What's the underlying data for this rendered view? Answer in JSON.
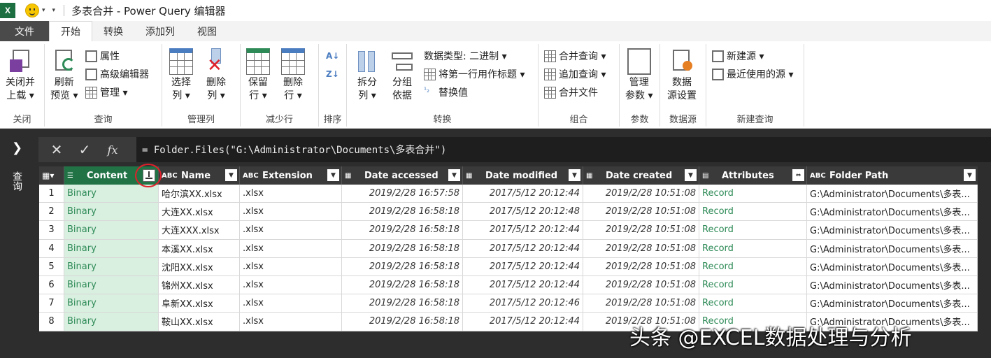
{
  "window": {
    "app_logo": "X",
    "title": "多表合并 - Power Query 编辑器"
  },
  "tabs": [
    {
      "label": "文件"
    },
    {
      "label": "开始"
    },
    {
      "label": "转换"
    },
    {
      "label": "添加列"
    },
    {
      "label": "视图"
    }
  ],
  "ribbon": {
    "close": {
      "label1": "关闭并",
      "label2": "上载 ▾",
      "group": "关闭"
    },
    "query": {
      "refresh1": "刷新",
      "refresh2": "预览 ▾",
      "props": "属性",
      "adv": "高级编辑器",
      "manage": "管理 ▾",
      "group": "查询"
    },
    "cols": {
      "select1": "选择",
      "select2": "列 ▾",
      "remove1": "删除",
      "remove2": "列 ▾",
      "group": "管理列"
    },
    "rows": {
      "keep1": "保留",
      "keep2": "行 ▾",
      "del1": "删除",
      "del2": "行 ▾",
      "group": "减少行"
    },
    "sort": {
      "group": "排序"
    },
    "transform": {
      "split1": "拆分",
      "split2": "列 ▾",
      "grp1": "分组",
      "grp2": "依据",
      "datatype": "数据类型: 二进制 ▾",
      "header": "将第一行用作标题 ▾",
      "replace": "替换值",
      "group": "转换"
    },
    "combine": {
      "merge": "合并查询 ▾",
      "append": "追加查询 ▾",
      "files": "合并文件",
      "group": "组合"
    },
    "params": {
      "l1": "管理",
      "l2": "参数 ▾",
      "group": "参数"
    },
    "source": {
      "l1": "数据",
      "l2": "源设置",
      "group": "数据源"
    },
    "newq": {
      "newsrc": "新建源 ▾",
      "recent": "最近使用的源 ▾",
      "group": "新建查询"
    }
  },
  "left_pane": {
    "label": "查询"
  },
  "formula": "= Folder.Files(\"G:\\Administrator\\Documents\\多表合并\")",
  "columns": [
    {
      "name": "Content",
      "type": "☰"
    },
    {
      "name": "Name",
      "type": "ABC"
    },
    {
      "name": "Extension",
      "type": "ABC"
    },
    {
      "name": "Date accessed",
      "type": "▦"
    },
    {
      "name": "Date modified",
      "type": "▦"
    },
    {
      "name": "Date created",
      "type": "▦"
    },
    {
      "name": "Attributes",
      "type": "▤"
    },
    {
      "name": "Folder Path",
      "type": "ABC"
    }
  ],
  "rows": [
    {
      "n": "1",
      "content": "Binary",
      "name": "哈尔滨XX.xlsx",
      "ext": ".xlsx",
      "accessed": "2019/2/28 16:57:58",
      "modified": "2017/5/12 20:12:44",
      "created": "2019/2/28 10:51:08",
      "attr": "Record",
      "path": "G:\\Administrator\\Documents\\多表..."
    },
    {
      "n": "2",
      "content": "Binary",
      "name": "大连XX.xlsx",
      "ext": ".xlsx",
      "accessed": "2019/2/28 16:58:18",
      "modified": "2017/5/12 20:12:48",
      "created": "2019/2/28 10:51:08",
      "attr": "Record",
      "path": "G:\\Administrator\\Documents\\多表..."
    },
    {
      "n": "3",
      "content": "Binary",
      "name": "大连XXX.xlsx",
      "ext": ".xlsx",
      "accessed": "2019/2/28 16:58:18",
      "modified": "2017/5/12 20:12:44",
      "created": "2019/2/28 10:51:08",
      "attr": "Record",
      "path": "G:\\Administrator\\Documents\\多表..."
    },
    {
      "n": "4",
      "content": "Binary",
      "name": "本溪XX.xlsx",
      "ext": ".xlsx",
      "accessed": "2019/2/28 16:58:18",
      "modified": "2017/5/12 20:12:44",
      "created": "2019/2/28 10:51:08",
      "attr": "Record",
      "path": "G:\\Administrator\\Documents\\多表..."
    },
    {
      "n": "5",
      "content": "Binary",
      "name": "沈阳XX.xlsx",
      "ext": ".xlsx",
      "accessed": "2019/2/28 16:58:18",
      "modified": "2017/5/12 20:12:44",
      "created": "2019/2/28 10:51:08",
      "attr": "Record",
      "path": "G:\\Administrator\\Documents\\多表..."
    },
    {
      "n": "6",
      "content": "Binary",
      "name": "锦州XX.xlsx",
      "ext": ".xlsx",
      "accessed": "2019/2/28 16:58:18",
      "modified": "2017/5/12 20:12:44",
      "created": "2019/2/28 10:51:08",
      "attr": "Record",
      "path": "G:\\Administrator\\Documents\\多表..."
    },
    {
      "n": "7",
      "content": "Binary",
      "name": "阜新XX.xlsx",
      "ext": ".xlsx",
      "accessed": "2019/2/28 16:58:18",
      "modified": "2017/5/12 20:12:46",
      "created": "2019/2/28 10:51:08",
      "attr": "Record",
      "path": "G:\\Administrator\\Documents\\多表..."
    },
    {
      "n": "8",
      "content": "Binary",
      "name": "鞍山XX.xlsx",
      "ext": ".xlsx",
      "accessed": "2019/2/28 16:58:18",
      "modified": "2017/5/12 20:12:44",
      "created": "2019/2/28 10:51:08",
      "attr": "Record",
      "path": "G:\\Administrator\\Documents\\多表..."
    }
  ],
  "watermark": "头条 @EXCEL数据处理与分析"
}
